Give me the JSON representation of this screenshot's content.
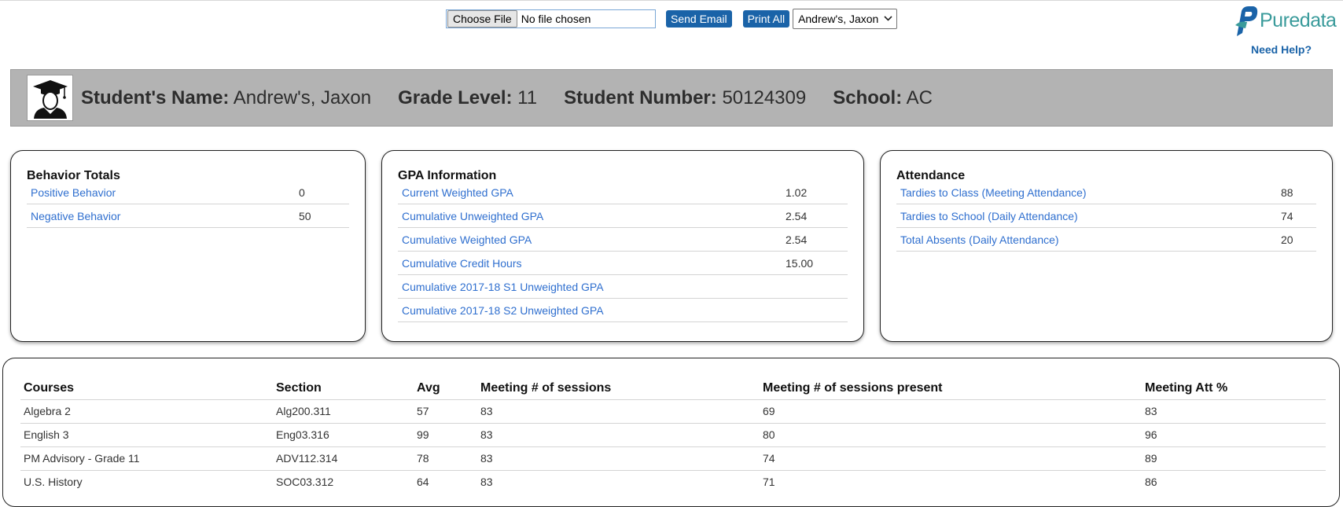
{
  "toolbar": {
    "choose_file_label": "Choose File",
    "file_status": "No file chosen",
    "send_email_label": "Send Email",
    "print_all_label": "Print All",
    "student_selected": "Andrew's, Jaxon"
  },
  "logo": {
    "text": "Puredata"
  },
  "help": {
    "label": "Need Help?"
  },
  "student": {
    "name_label": "Student's Name:",
    "name": "Andrew's, Jaxon",
    "grade_label": "Grade Level:",
    "grade": "11",
    "number_label": "Student Number:",
    "number": "50124309",
    "school_label": "School:",
    "school": "AC"
  },
  "behavior": {
    "title": "Behavior Totals",
    "rows": [
      {
        "label": "Positive Behavior",
        "value": "0"
      },
      {
        "label": "Negative Behavior",
        "value": "50"
      }
    ]
  },
  "gpa": {
    "title": "GPA Information",
    "rows": [
      {
        "label": "Current Weighted GPA",
        "value": "1.02"
      },
      {
        "label": "Cumulative Unweighted GPA",
        "value": "2.54"
      },
      {
        "label": "Cumulative Weighted GPA",
        "value": "2.54"
      },
      {
        "label": "Cumulative Credit Hours",
        "value": "15.00"
      },
      {
        "label": "Cumulative 2017-18 S1 Unweighted GPA",
        "value": ""
      },
      {
        "label": "Cumulative 2017-18 S2 Unweighted GPA",
        "value": ""
      }
    ]
  },
  "attendance": {
    "title": "Attendance",
    "rows": [
      {
        "label": "Tardies to Class (Meeting Attendance)",
        "value": "88"
      },
      {
        "label": "Tardies to School (Daily Attendance)",
        "value": "74"
      },
      {
        "label": "Total Absents (Daily Attendance)",
        "value": "20"
      }
    ]
  },
  "courses": {
    "headers": [
      "Courses",
      "Section",
      "Avg",
      "Meeting # of sessions",
      "Meeting # of sessions present",
      "Meeting Att %"
    ],
    "rows": [
      [
        "Algebra 2",
        "Alg200.311",
        "57",
        "83",
        "69",
        "83"
      ],
      [
        "English 3",
        "Eng03.316",
        "99",
        "83",
        "80",
        "96"
      ],
      [
        "PM Advisory - Grade 11",
        "ADV112.314",
        "78",
        "83",
        "74",
        "89"
      ],
      [
        "U.S. History",
        "SOC03.312",
        "64",
        "83",
        "71",
        "86"
      ]
    ]
  },
  "colors": {
    "button_blue": "#1a63a8",
    "link_blue": "#2f6fcf",
    "banner_gray": "#b3b3b3",
    "logo_teal": "#3a9b9b"
  },
  "icons": {
    "logo_mark": "puredata-logo-icon",
    "avatar": "graduate-avatar-icon",
    "select_arrow": "chevron-down-icon"
  }
}
